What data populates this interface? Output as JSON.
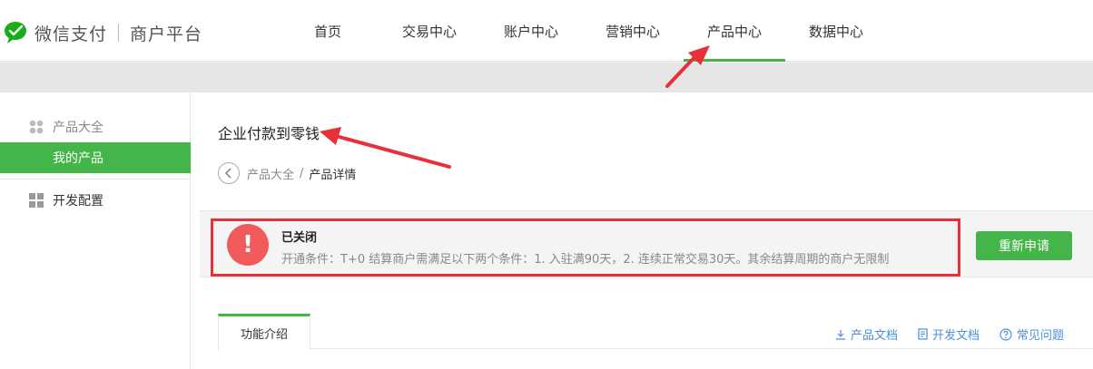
{
  "brand": {
    "name": "微信支付",
    "sub": "商户平台"
  },
  "nav": {
    "items": [
      {
        "label": "首页"
      },
      {
        "label": "交易中心"
      },
      {
        "label": "账户中心"
      },
      {
        "label": "营销中心"
      },
      {
        "label": "产品中心"
      },
      {
        "label": "数据中心"
      }
    ],
    "active_index": 4
  },
  "sidebar": {
    "groups": [
      {
        "label": "产品大全",
        "icon": "apps-icon",
        "sub": "我的产品"
      },
      {
        "label": "开发配置",
        "icon": "grid-icon"
      }
    ]
  },
  "main": {
    "title": "企业付款到零钱",
    "breadcrumb": {
      "parent": "产品大全",
      "sep": "/",
      "current": "产品详情"
    },
    "notice": {
      "status": "已关闭",
      "icon": "!",
      "desc": "开通条件：T+0 结算商户需满足以下两个条件：1. 入驻满90天，2. 连续正常交易30天。其余结算周期的商户无限制"
    },
    "reapply_label": "重新申请",
    "tabs": [
      {
        "label": "功能介绍"
      }
    ],
    "links": [
      {
        "label": "产品文档",
        "icon": "download-icon"
      },
      {
        "label": "开发文档",
        "icon": "document-icon"
      },
      {
        "label": "常见问题",
        "icon": "help-icon"
      }
    ]
  },
  "colors": {
    "accent": "#44b549",
    "alert": "#f05a5a",
    "highlight": "#e8303a",
    "link": "#4a90d9"
  }
}
